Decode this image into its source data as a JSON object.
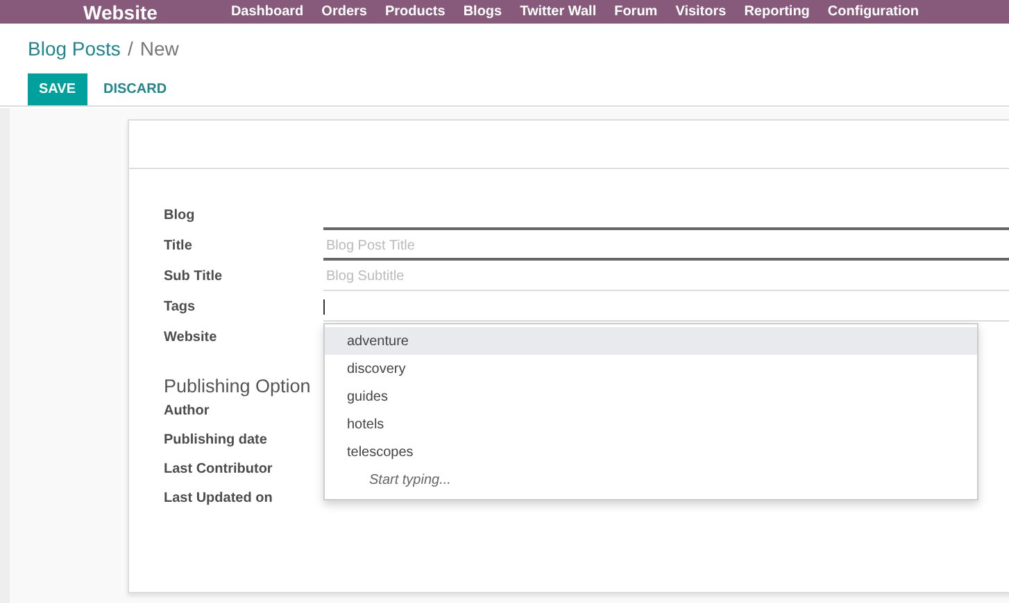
{
  "topbar": {
    "app_title": "Website",
    "menu": [
      "Dashboard",
      "Orders",
      "Products",
      "Blogs",
      "Twitter Wall",
      "Forum",
      "Visitors",
      "Reporting",
      "Configuration"
    ]
  },
  "breadcrumb": {
    "parent": "Blog Posts",
    "separator": "/",
    "current": "New"
  },
  "buttons": [
    {
      "label": "SAVE",
      "kind": "primary"
    },
    {
      "label": "DISCARD",
      "kind": "link"
    }
  ],
  "fields": [
    {
      "label": "Blog",
      "required": true
    },
    {
      "label": "Title",
      "placeholder": "Blog Post Title",
      "required": true
    },
    {
      "label": "Sub Title",
      "placeholder": "Blog Subtitle",
      "required": false
    },
    {
      "label": "Tags",
      "required": false,
      "focused": true
    },
    {
      "label": "Website",
      "required": false
    }
  ],
  "section": {
    "title": "Publishing Option",
    "fields": [
      "Author",
      "Publishing date",
      "Last Contributor",
      "Last Updated on"
    ]
  },
  "dropdown": {
    "items": [
      {
        "label": "adventure",
        "selected": true
      },
      {
        "label": "discovery",
        "selected": false
      },
      {
        "label": "guides",
        "selected": false
      },
      {
        "label": "hotels",
        "selected": false
      },
      {
        "label": "telescopes",
        "selected": false
      }
    ],
    "hint": "Start typing..."
  }
}
